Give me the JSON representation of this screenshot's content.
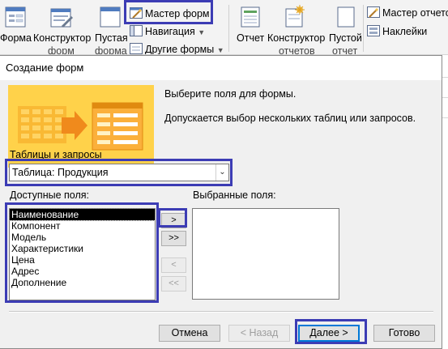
{
  "ribbon": {
    "form_label": "Форма",
    "form_designer_label": "Конструктор",
    "form_designer_label2": "форм",
    "blank_form_label": "Пустая",
    "blank_form_label2": "форма",
    "form_wizard_label": "Мастер форм",
    "navigation_label": "Навигация",
    "other_forms_label": "Другие формы",
    "report_label": "Отчет",
    "report_designer_label": "Конструктор",
    "report_designer_label2": "отчетов",
    "blank_report_label": "Пустой",
    "blank_report_label2": "отчет",
    "report_wizard_label": "Мастер отчето",
    "labels_label": "Наклейки"
  },
  "dialog": {
    "title": "Создание форм",
    "prompt_main": "Выберите поля для формы.",
    "prompt_hint": "Допускается выбор нескольких таблиц или запросов.",
    "tables_label": "Таблицы и запросы",
    "tables_value": "Таблица: Продукция",
    "available_label": "Доступные поля:",
    "selected_label": "Выбранные поля:",
    "available_fields": [
      "Наименование",
      "Компонент",
      "Модель",
      "Характеристики",
      "Цена",
      "Адрес",
      "Дополнение"
    ],
    "move_one": ">",
    "move_all": ">>",
    "remove_one": "<",
    "remove_all": "<<",
    "cancel": "Отмена",
    "back": "< Назад",
    "next": "Далее >",
    "finish": "Готово"
  },
  "colors": {
    "highlight": "#3c3cb4",
    "banner": "#ffd24a"
  }
}
